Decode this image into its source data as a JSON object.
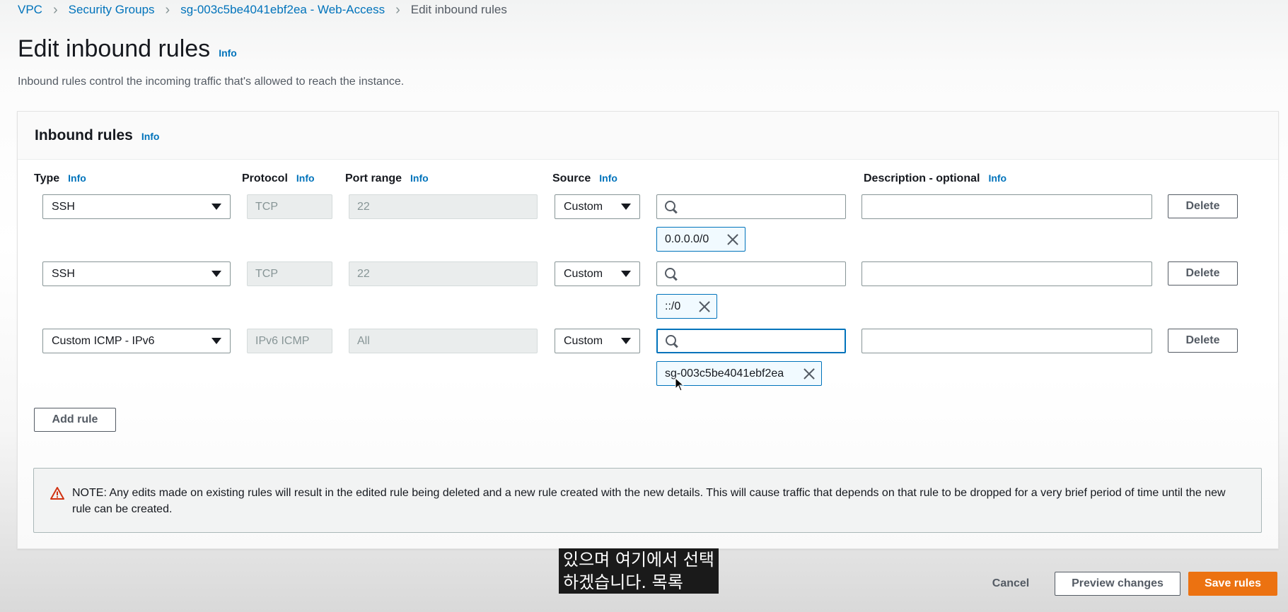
{
  "breadcrumb": {
    "items": [
      "VPC",
      "Security Groups",
      "sg-003c5be4041ebf2ea - Web-Access"
    ],
    "current": "Edit inbound rules"
  },
  "page": {
    "title": "Edit inbound rules",
    "info": "Info",
    "description": "Inbound rules control the incoming traffic that's allowed to reach the instance."
  },
  "panel": {
    "title": "Inbound rules",
    "info": "Info",
    "columns": {
      "type": "Type",
      "protocol": "Protocol",
      "port_range": "Port range",
      "source": "Source",
      "description": "Description - optional",
      "info": "Info"
    }
  },
  "rules": [
    {
      "type": "SSH",
      "protocol": "TCP",
      "port": "22",
      "source": "Custom",
      "search_value": "",
      "token": "0.0.0.0/0",
      "description": "",
      "delete_label": "Delete"
    },
    {
      "type": "SSH",
      "protocol": "TCP",
      "port": "22",
      "source": "Custom",
      "search_value": "",
      "token": "::/0",
      "description": "",
      "delete_label": "Delete"
    },
    {
      "type": "Custom ICMP - IPv6",
      "protocol": "IPv6 ICMP",
      "port": "All",
      "source": "Custom",
      "search_value": "",
      "token": "sg-003c5be4041ebf2ea",
      "description": "",
      "delete_label": "Delete"
    }
  ],
  "add_rule_label": "Add rule",
  "note": "NOTE: Any edits made on existing rules will result in the edited rule being deleted and a new rule created with the new details. This will cause traffic that depends on that rule to be dropped for a very brief period of time until the new rule can be created.",
  "subtitle": {
    "line1": "있으며 여기에서 선택",
    "line2": "하겠습니다. 목록"
  },
  "footer": {
    "cancel": "Cancel",
    "preview": "Preview changes",
    "save": "Save rules"
  },
  "colors": {
    "link": "#0073bb",
    "primary": "#ec7211",
    "warning": "#d13212"
  },
  "icons": [
    "chevron-right-icon",
    "caret-down-icon",
    "search-icon",
    "close-icon",
    "warning-icon",
    "mouse-cursor-icon"
  ]
}
